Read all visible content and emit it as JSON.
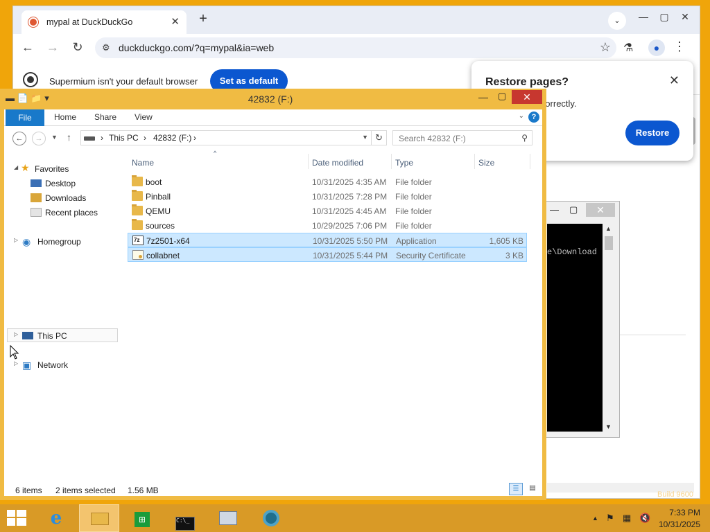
{
  "browser": {
    "tab_title": "mypal at DuckDuckGo",
    "url": "duckduckgo.com/?q=mypal&ia=web",
    "infobar_message": "Supermium isn't your default browser",
    "set_default_label": "Set as default",
    "restore": {
      "title": "Restore pages?",
      "body": "n't shut down correctly.",
      "button": "Restore"
    }
  },
  "console": {
    "visible_text": "e\\Download"
  },
  "explorer": {
    "window_title": "42832 (F:)",
    "ribbon_tabs": [
      "File",
      "Home",
      "Share",
      "View"
    ],
    "breadcrumb": [
      "This PC",
      "42832 (F:)"
    ],
    "search_placeholder": "Search 42832 (F:)",
    "nav": {
      "favorites": "Favorites",
      "desktop": "Desktop",
      "downloads": "Downloads",
      "recent_places": "Recent places",
      "homegroup": "Homegroup",
      "this_pc": "This PC",
      "network": "Network"
    },
    "columns": [
      "Name",
      "Date modified",
      "Type",
      "Size"
    ],
    "files": [
      {
        "name": "boot",
        "date": "10/31/2025 4:35 AM",
        "type": "File folder",
        "size": "",
        "icon": "folder-icon",
        "selected": false
      },
      {
        "name": "Pinball",
        "date": "10/31/2025 7:28 PM",
        "type": "File folder",
        "size": "",
        "icon": "folder-icon",
        "selected": false
      },
      {
        "name": "QEMU",
        "date": "10/31/2025 4:45 AM",
        "type": "File folder",
        "size": "",
        "icon": "folder-icon",
        "selected": false
      },
      {
        "name": "sources",
        "date": "10/29/2025 7:06 PM",
        "type": "File folder",
        "size": "",
        "icon": "folder-icon",
        "selected": false
      },
      {
        "name": "7z2501-x64",
        "date": "10/31/2025 5:50 PM",
        "type": "Application",
        "size": "1,605 KB",
        "icon": "application-icon",
        "selected": true
      },
      {
        "name": "collabnet",
        "date": "10/31/2025 5:44 PM",
        "type": "Security Certificate",
        "size": "3 KB",
        "icon": "certificate-icon",
        "selected": true
      }
    ],
    "status": {
      "item_count": "6 items",
      "selected": "2 items selected",
      "selected_size": "1.56 MB"
    }
  },
  "taskbar": {
    "apps": [
      "internet-explorer-icon",
      "file-explorer-icon",
      "store-icon",
      "command-prompt-icon",
      "resource-monitor-icon",
      "supermium-icon"
    ],
    "time": "7:33 PM",
    "date": "10/31/2025"
  },
  "desktop": {
    "watermark": "Build 9600"
  },
  "colors": {
    "desktop": "#f0a50a",
    "explorer_frame": "#f0bb43",
    "accent_blue": "#0b57d0",
    "selection": "#cce8ff",
    "taskbar": "#d99a26"
  }
}
